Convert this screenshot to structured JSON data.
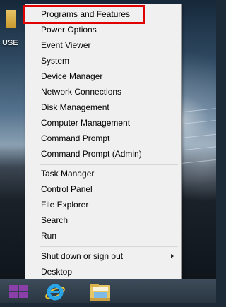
{
  "desktop": {
    "icon_label": "USE"
  },
  "menu": {
    "items": [
      {
        "label": "Programs and Features"
      },
      {
        "label": "Power Options"
      },
      {
        "label": "Event Viewer"
      },
      {
        "label": "System"
      },
      {
        "label": "Device Manager"
      },
      {
        "label": "Network Connections"
      },
      {
        "label": "Disk Management"
      },
      {
        "label": "Computer Management"
      },
      {
        "label": "Command Prompt"
      },
      {
        "label": "Command Prompt (Admin)"
      },
      {
        "label": "Task Manager"
      },
      {
        "label": "Control Panel"
      },
      {
        "label": "File Explorer"
      },
      {
        "label": "Search"
      },
      {
        "label": "Run"
      },
      {
        "label": "Shut down or sign out"
      },
      {
        "label": "Desktop"
      }
    ],
    "highlight_color": "#e00000"
  },
  "taskbar": {
    "start_icon": "windows-logo-icon",
    "pinned": [
      "internet-explorer-icon",
      "file-explorer-icon"
    ],
    "accent": "#8b3fa8"
  }
}
